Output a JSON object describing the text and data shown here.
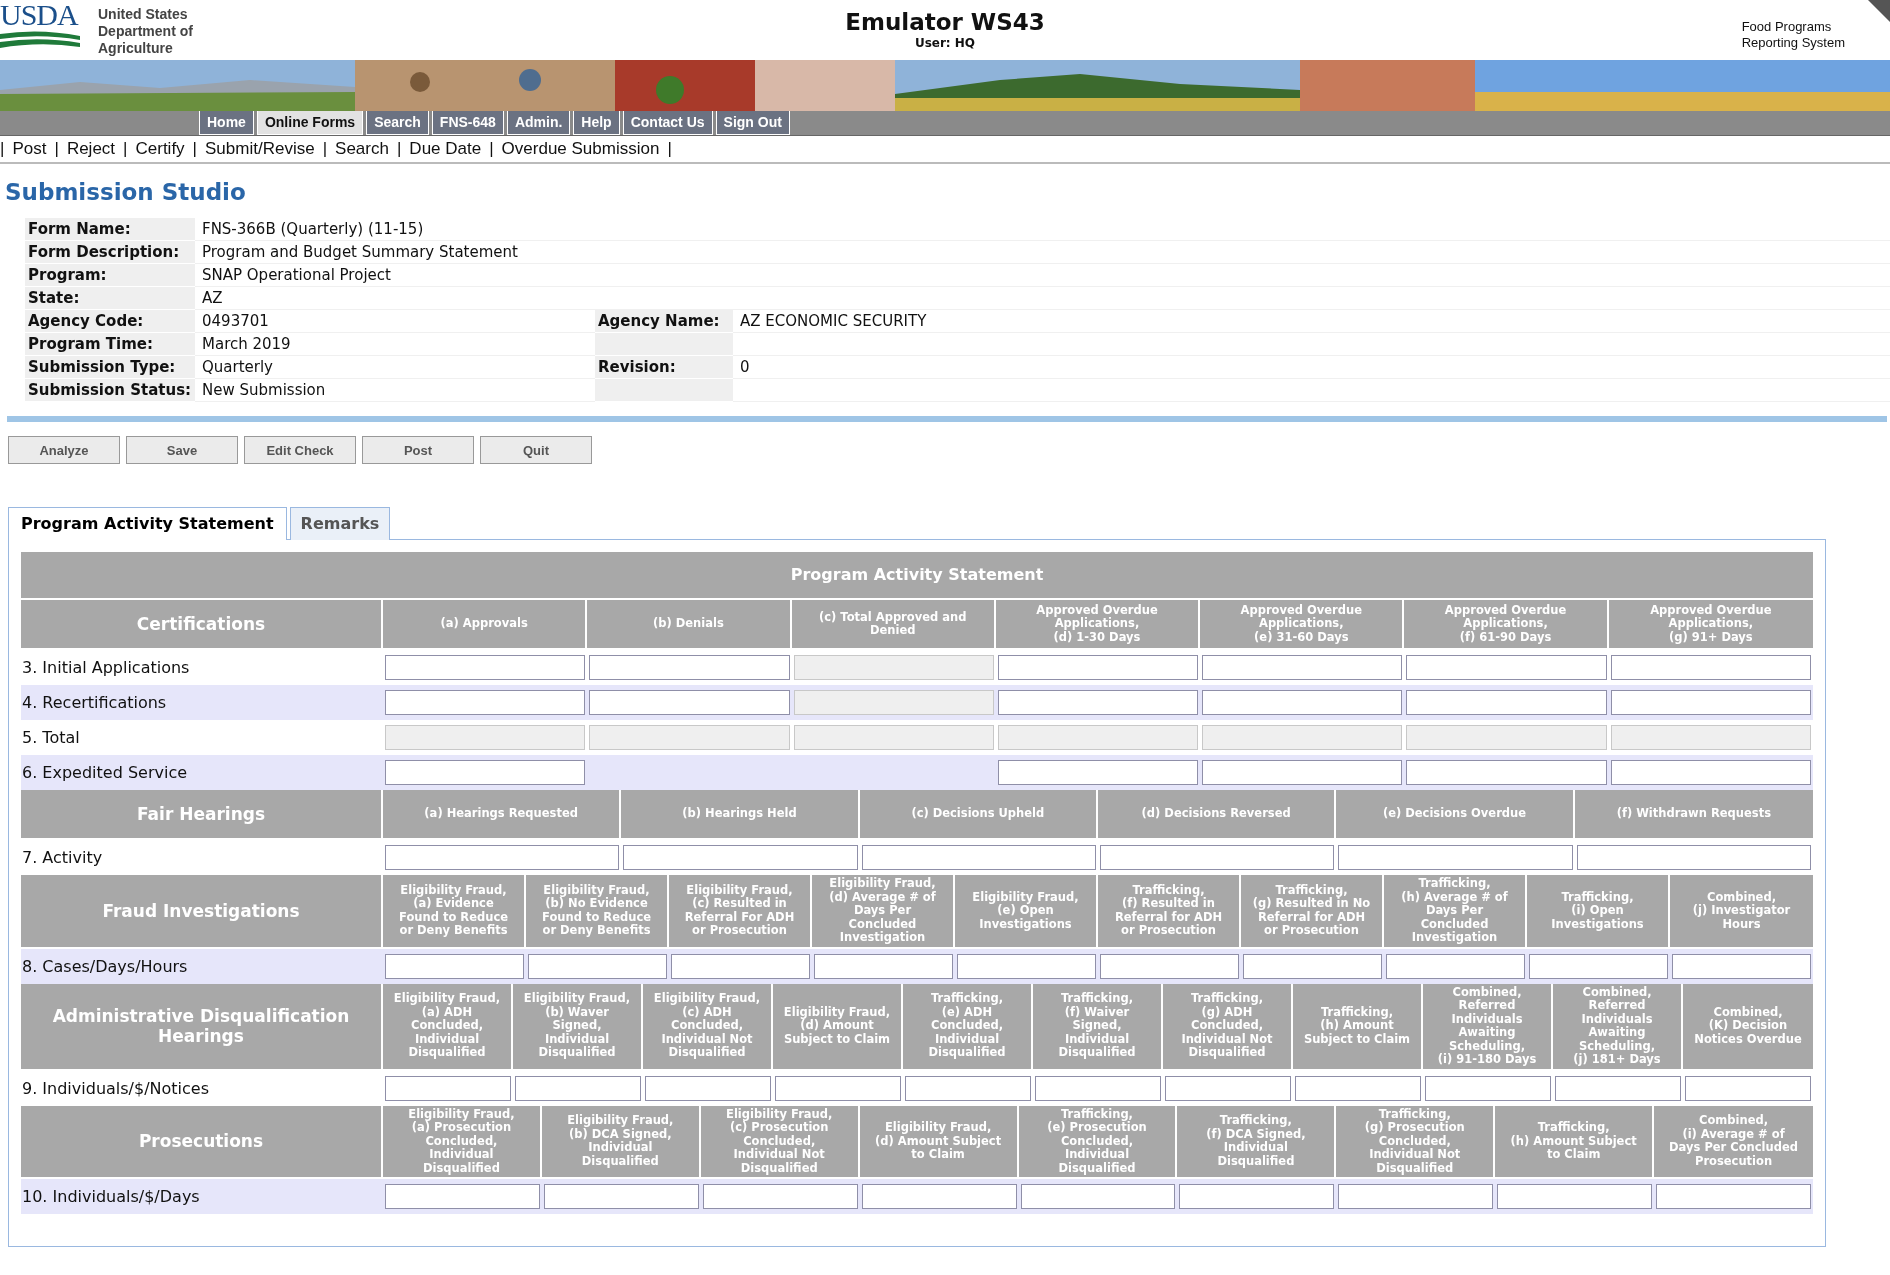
{
  "header": {
    "logo": "USDA",
    "agency_lines": [
      "United States",
      "Department of",
      "Agriculture"
    ],
    "title": "Emulator WS43",
    "user": "User: HQ",
    "system_lines": [
      "Food Programs",
      "Reporting System"
    ]
  },
  "nav": [
    {
      "label": "Home",
      "selected": false
    },
    {
      "label": "Online Forms",
      "selected": true
    },
    {
      "label": "Search",
      "selected": false
    },
    {
      "label": "FNS-648",
      "selected": false
    },
    {
      "label": "Admin.",
      "selected": false
    },
    {
      "label": "Help",
      "selected": false
    },
    {
      "label": "Contact Us",
      "selected": false
    },
    {
      "label": "Sign Out",
      "selected": false
    }
  ],
  "submenu": {
    "separator": "|",
    "items": [
      "Post",
      "Reject",
      "Certify",
      "Submit/Revise",
      "Search",
      "Due Date",
      "Overdue Submission"
    ]
  },
  "page_title": "Submission Studio",
  "form_info": [
    {
      "label": "Form Name:",
      "value": "FNS-366B (Quarterly) (11-15)"
    },
    {
      "label": "Form Description:",
      "value": "Program and Budget Summary Statement"
    },
    {
      "label": "Program:",
      "value": "SNAP Operational Project"
    },
    {
      "label": "State:",
      "value": "AZ"
    },
    {
      "label": "Agency Code:",
      "value": "0493701",
      "extra": {
        "label": "Agency Name:",
        "value": "AZ ECONOMIC SECURITY"
      }
    },
    {
      "label": "Program Time:",
      "value": "March 2019"
    },
    {
      "label": "Submission Type:",
      "value": "Quarterly",
      "extra": {
        "label": "Revision:",
        "value": "0"
      }
    },
    {
      "label": "Submission Status:",
      "value": "New Submission"
    }
  ],
  "buttons": [
    "Analyze",
    "Save",
    "Edit Check",
    "Post",
    "Quit"
  ],
  "tabs": [
    {
      "label": "Program Activity Statement",
      "selected": true
    },
    {
      "label": "Remarks",
      "selected": false
    }
  ],
  "statement": {
    "title": "Program Activity Statement",
    "sections": [
      {
        "heading": "Certifications",
        "columns": [
          "(a) Approvals",
          "(b) Denials",
          "(c) Total Approved and\nDenied",
          "Approved Overdue\nApplications,\n(d) 1-30 Days",
          "Approved Overdue\nApplications,\n(e) 31-60 Days",
          "Approved Overdue\nApplications,\n(f) 61-90 Days",
          "Approved Overdue\nApplications,\n(g) 91+ Days"
        ],
        "rows": [
          {
            "label": "3. Initial Applications",
            "shaded": false,
            "cells": [
              {
                "kind": "input"
              },
              {
                "kind": "input"
              },
              {
                "kind": "readonly"
              },
              {
                "kind": "input"
              },
              {
                "kind": "input"
              },
              {
                "kind": "input"
              },
              {
                "kind": "input"
              }
            ]
          },
          {
            "label": "4. Recertifications",
            "shaded": true,
            "cells": [
              {
                "kind": "input"
              },
              {
                "kind": "input"
              },
              {
                "kind": "readonly"
              },
              {
                "kind": "input"
              },
              {
                "kind": "input"
              },
              {
                "kind": "input"
              },
              {
                "kind": "input"
              }
            ]
          },
          {
            "label": "5. Total",
            "shaded": false,
            "cells": [
              {
                "kind": "readonly"
              },
              {
                "kind": "readonly"
              },
              {
                "kind": "readonly"
              },
              {
                "kind": "readonly"
              },
              {
                "kind": "readonly"
              },
              {
                "kind": "readonly"
              },
              {
                "kind": "readonly"
              }
            ]
          },
          {
            "label": "6. Expedited Service",
            "shaded": true,
            "cells": [
              {
                "kind": "input"
              },
              {
                "kind": "blank"
              },
              {
                "kind": "blank"
              },
              {
                "kind": "input"
              },
              {
                "kind": "input"
              },
              {
                "kind": "input"
              },
              {
                "kind": "input"
              }
            ]
          }
        ]
      },
      {
        "heading": "Fair Hearings",
        "columns": [
          "(a) Hearings Requested",
          "(b) Hearings Held",
          "(c) Decisions Upheld",
          "(d) Decisions Reversed",
          "(e) Decisions Overdue",
          "(f) Withdrawn Requests"
        ],
        "rows": [
          {
            "label": "7. Activity",
            "shaded": false,
            "cells": [
              {
                "kind": "input"
              },
              {
                "kind": "input"
              },
              {
                "kind": "input"
              },
              {
                "kind": "input"
              },
              {
                "kind": "input"
              },
              {
                "kind": "input"
              }
            ]
          }
        ]
      },
      {
        "heading": "Fraud Investigations",
        "columns": [
          "Eligibility Fraud,\n(a) Evidence\nFound to Reduce\nor Deny Benefits",
          "Eligibility Fraud,\n(b) No Evidence\nFound to Reduce\nor Deny Benefits",
          "Eligibility Fraud,\n(c) Resulted in\nReferral For ADH\nor Prosecution",
          "Eligibility Fraud,\n(d) Average # of\nDays Per\nConcluded\nInvestigation",
          "Eligibility Fraud,\n(e) Open\nInvestigations",
          "Trafficking,\n(f) Resulted in\nReferral for ADH\nor Prosecution",
          "Trafficking,\n(g) Resulted in No\nReferral for ADH\nor Prosecution",
          "Trafficking,\n(h) Average # of\nDays Per\nConcluded\nInvestigation",
          "Trafficking,\n(i) Open\nInvestigations",
          "Combined,\n(j) Investigator\nHours"
        ],
        "rows": [
          {
            "label": "8. Cases/Days/Hours",
            "shaded": true,
            "cells": [
              {
                "kind": "input"
              },
              {
                "kind": "input"
              },
              {
                "kind": "input"
              },
              {
                "kind": "input"
              },
              {
                "kind": "input"
              },
              {
                "kind": "input"
              },
              {
                "kind": "input"
              },
              {
                "kind": "input"
              },
              {
                "kind": "input"
              },
              {
                "kind": "input"
              }
            ]
          }
        ]
      },
      {
        "heading": "Administrative Disqualification Hearings",
        "columns": [
          "Eligibility Fraud,\n(a) ADH\nConcluded,\nIndividual\nDisqualified",
          "Eligibility Fraud,\n(b) Waver\nSigned,\nIndividual\nDisqualified",
          "Eligibility Fraud,\n(c) ADH\nConcluded,\nIndividual Not\nDisqualified",
          "Eligibility Fraud,\n(d) Amount\nSubject to Claim",
          "Trafficking,\n(e) ADH\nConcluded,\nIndividual\nDisqualified",
          "Trafficking,\n(f) Waiver\nSigned,\nIndividual\nDisqualified",
          "Trafficking,\n(g) ADH\nConcluded,\nIndividual Not\nDisqualified",
          "Trafficking,\n(h) Amount\nSubject to Claim",
          "Combined,\nReferred\nIndividuals\nAwaiting\nScheduling,\n(i) 91-180 Days",
          "Combined,\nReferred\nIndividuals\nAwaiting\nScheduling,\n(j) 181+ Days",
          "Combined,\n(K) Decision\nNotices Overdue"
        ],
        "rows": [
          {
            "label": "9. Individuals/$/Notices",
            "shaded": false,
            "cells": [
              {
                "kind": "input"
              },
              {
                "kind": "input"
              },
              {
                "kind": "input"
              },
              {
                "kind": "input"
              },
              {
                "kind": "input"
              },
              {
                "kind": "input"
              },
              {
                "kind": "input"
              },
              {
                "kind": "input"
              },
              {
                "kind": "input"
              },
              {
                "kind": "input"
              },
              {
                "kind": "input"
              }
            ]
          }
        ]
      },
      {
        "heading": "Prosecutions",
        "columns": [
          "Eligibility Fraud,\n(a) Prosecution\nConcluded,\nIndividual\nDisqualified",
          "Eligibility Fraud,\n(b) DCA Signed,\nIndividual\nDisqualified",
          "Eligibility Fraud,\n(c) Prosecution\nConcluded,\nIndividual Not\nDisqualified",
          "Eligibility Fraud,\n(d) Amount Subject\nto Claim",
          "Trafficking,\n(e) Prosecution\nConcluded,\nIndividual\nDisqualified",
          "Trafficking,\n(f) DCA Signed,\nIndividual\nDisqualified",
          "Trafficking,\n(g) Prosecution\nConcluded,\nIndividual Not\nDisqualified",
          "Trafficking,\n(h) Amount Subject\nto Claim",
          "Combined,\n(i) Average # of\nDays Per Concluded\nProsecution"
        ],
        "rows": [
          {
            "label": "10. Individuals/$/Days",
            "shaded": true,
            "cells": [
              {
                "kind": "input"
              },
              {
                "kind": "input"
              },
              {
                "kind": "input"
              },
              {
                "kind": "input"
              },
              {
                "kind": "input"
              },
              {
                "kind": "input"
              },
              {
                "kind": "input"
              },
              {
                "kind": "input"
              },
              {
                "kind": "input"
              }
            ]
          }
        ]
      }
    ]
  }
}
